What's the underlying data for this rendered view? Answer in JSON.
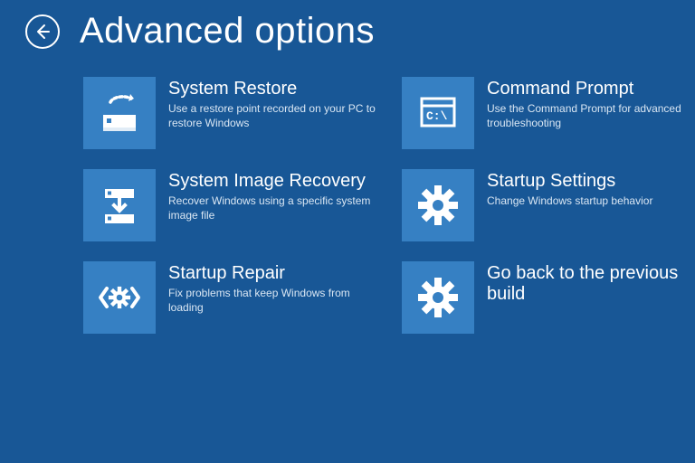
{
  "header": {
    "title": "Advanced options"
  },
  "tiles": [
    {
      "title": "System Restore",
      "desc": "Use a restore point recorded on your PC to restore Windows"
    },
    {
      "title": "Command Prompt",
      "desc": "Use the Command Prompt for advanced troubleshooting"
    },
    {
      "title": "System Image Recovery",
      "desc": "Recover Windows using a specific system image file"
    },
    {
      "title": "Startup Settings",
      "desc": "Change Windows startup behavior"
    },
    {
      "title": "Startup Repair",
      "desc": "Fix problems that keep Windows from loading"
    },
    {
      "title": "Go back to the previous build",
      "desc": ""
    }
  ],
  "colors": {
    "bg": "#185796",
    "tile": "#3680c3",
    "fg": "#ffffff"
  }
}
